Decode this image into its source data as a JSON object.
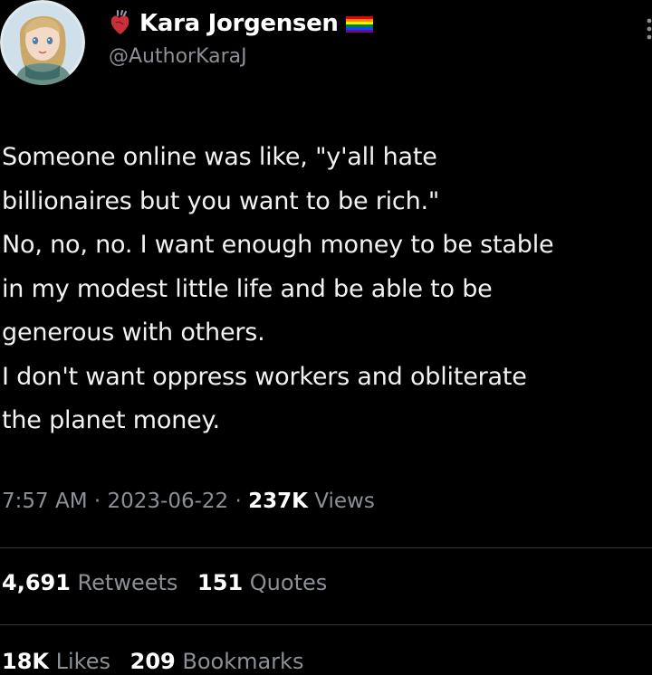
{
  "author": {
    "display_name": "Kara Jorgensen",
    "handle": "@AuthorKaraJ",
    "avatar_icon": "avatar-illustration",
    "badge_icons": [
      "anatomical-heart-icon",
      "rainbow-flag-icon"
    ]
  },
  "tweet": {
    "lines": [
      "Someone online was like, \"y'all hate",
      "billionaires but you want to be rich.\"",
      "No, no, no. I want enough money to be stable",
      "in my modest little life and be able to be",
      "generous with others.",
      "I don't want oppress workers and obliterate",
      "the planet money."
    ]
  },
  "meta": {
    "time": "7:57 AM",
    "sep1": " · ",
    "date": "2023-06-22",
    "sep2": " · ",
    "views_count": "237K",
    "views_label": " Views"
  },
  "stats": {
    "retweets_count": "4,691",
    "retweets_label": " Retweets",
    "quotes_count": "151",
    "quotes_label": " Quotes",
    "likes_count": "18K",
    "likes_label": " Likes",
    "bookmarks_count": "209",
    "bookmarks_label": " Bookmarks"
  },
  "colors": {
    "background": "#000000",
    "text": "#f2f2f2",
    "muted": "#8b9096",
    "divider": "#2f3336"
  }
}
